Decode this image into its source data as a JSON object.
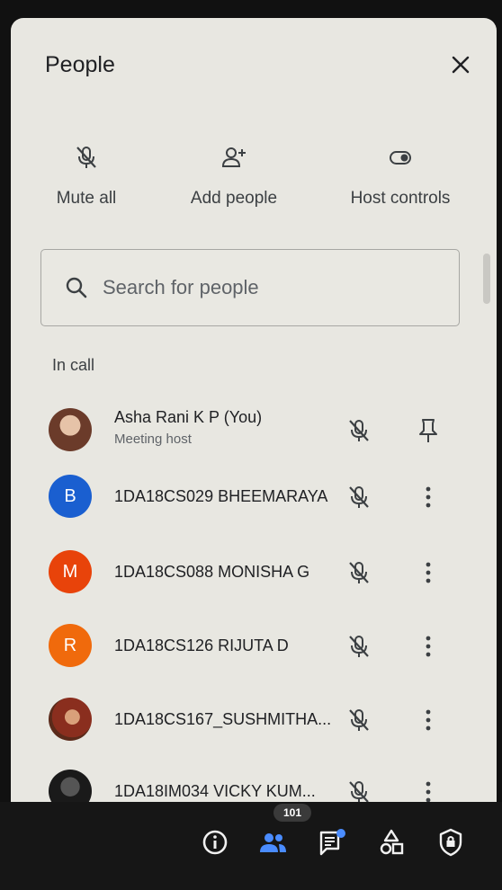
{
  "panel": {
    "title": "People",
    "close_icon": "close-icon"
  },
  "actions": [
    {
      "label": "Mute all",
      "icon": "mic-off-icon"
    },
    {
      "label": "Add people",
      "icon": "add-person-icon"
    },
    {
      "label": "Host controls",
      "icon": "toggle-icon"
    }
  ],
  "search": {
    "placeholder": "Search for people",
    "value": ""
  },
  "section": {
    "title": "In call"
  },
  "participants": [
    {
      "name": "Asha Rani K P (You)",
      "subtitle": "Meeting host",
      "avatar": "photo",
      "avatar_color": "#8a5a4a",
      "action_icon": "pin-icon"
    },
    {
      "name": "1DA18CS029 BHEEMARAYA",
      "initial": "B",
      "avatar_color": "#1a5fd0",
      "action_icon": "more-vert-icon"
    },
    {
      "name": "1DA18CS088 MONISHA G",
      "initial": "M",
      "avatar_color": "#e8430a",
      "action_icon": "more-vert-icon"
    },
    {
      "name": "1DA18CS126 RIJUTA D",
      "initial": "R",
      "avatar_color": "#f06a0c",
      "action_icon": "more-vert-icon"
    },
    {
      "name": "1DA18CS167_SUSHMITHA...",
      "avatar": "photo",
      "avatar_color": "#b05a40",
      "action_icon": "more-vert-icon"
    },
    {
      "name": "1DA18IM034 VICKY KUM...",
      "avatar": "photo",
      "avatar_color": "#222222",
      "action_icon": "more-vert-icon"
    }
  ],
  "bottom_bar": {
    "icons": [
      "info-icon",
      "people-icon",
      "chat-icon",
      "activities-icon",
      "host-safety-icon"
    ],
    "people_count": "101",
    "accent": "#4a8cff"
  }
}
